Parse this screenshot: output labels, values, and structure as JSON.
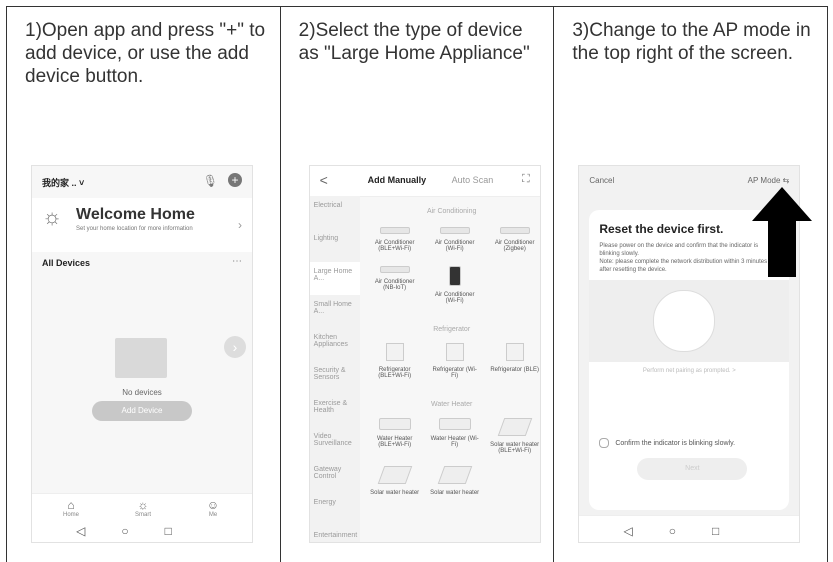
{
  "panel1": {
    "caption": "1)Open app and press \"+\" to add device, or use the add device button.",
    "home": {
      "title": "我的家 .. ˅",
      "welcome": "Welcome Home",
      "welcome_sub": "Set your home location for more information",
      "all_devices": "All Devices",
      "no_devices": "No devices",
      "add_device_btn": "Add Device",
      "nav": [
        "Home",
        "Smart",
        "Me"
      ]
    }
  },
  "panel2": {
    "caption": "2)Select the type of device as \"Large Home Appliance\"",
    "tabs": {
      "back": "<",
      "add_manually": "Add Manually",
      "auto_scan": "Auto Scan"
    },
    "left_menu": [
      "Electrical",
      "Lighting",
      "Large Home A...",
      "Small Home A...",
      "Kitchen Appliances",
      "Security & Sensors",
      "Exercise & Health",
      "Video Surveillance",
      "Gateway Control",
      "Energy",
      "Entertainment"
    ],
    "sections": [
      {
        "title": "Air Conditioning",
        "items": [
          "Air Conditioner (BLE+Wi-Fi)",
          "Air Conditioner (Wi-Fi)",
          "Air Conditioner (Zigbee)",
          "Air Conditioner (NB-IoT)",
          "Air Conditioner (Wi-Fi)"
        ]
      },
      {
        "title": "Refrigerator",
        "items": [
          "Refrigerator (BLE+Wi-Fi)",
          "Refrigerator (Wi-Fi)",
          "Refrigerator (BLE)"
        ]
      },
      {
        "title": "Water Heater",
        "items": [
          "Water Heater (BLE+Wi-Fi)",
          "Water Heater (Wi-Fi)",
          "Solar water heater (BLE+Wi-Fi)",
          "Solar water heater",
          "Solar water heater"
        ]
      }
    ]
  },
  "panel3": {
    "caption": "3)Change to the AP mode in the top right of the screen.",
    "top": {
      "cancel": "Cancel",
      "ap_mode": "AP Mode ⇆"
    },
    "reset_title": "Reset the device first.",
    "reset_body": "Please power on the device and confirm that the indicator is blinking slowly.\nNote: please complete the network distribution within 3 minutes after resetting the device.",
    "perform": "Perform net pairing as prompted. >",
    "confirm": "Confirm the indicator is blinking slowly.",
    "next_btn": "Next"
  }
}
